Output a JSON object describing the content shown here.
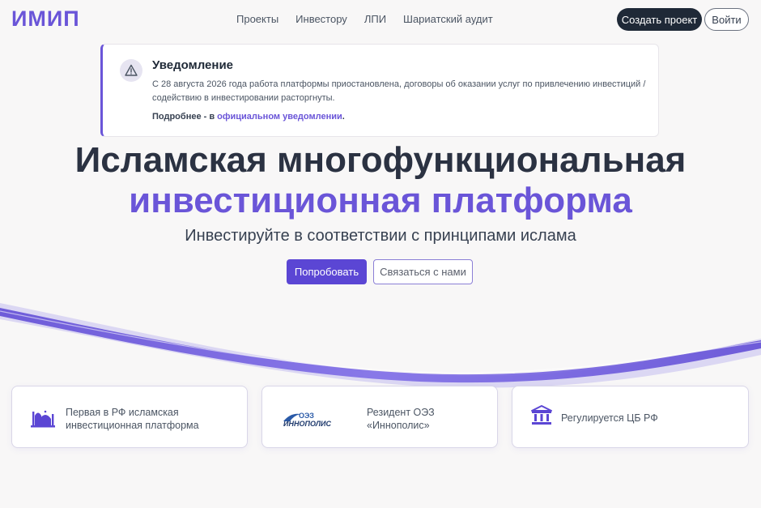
{
  "header": {
    "logo": "ИМИП",
    "nav": [
      "Проекты",
      "Инвестору",
      "ЛПИ",
      "Шариатский аудит"
    ],
    "create_project": "Создать проект",
    "login": "Войти"
  },
  "notice": {
    "title": "Уведомление",
    "text": "С 28 августа 2026 года работа платформы приостановлена, договоры об оказании услуг по привлечению инвестиций / содействию в инвестировании расторгнуты.",
    "more_prefix": "Подробнее - в ",
    "more_link": "официальном уведомлении",
    "more_suffix": "."
  },
  "hero": {
    "title_line1": "Исламская многофункциональная",
    "title_line2": "инвестиционная платформа",
    "subtitle": "Инвестируйте в соответствии с принципами ислама",
    "try_button": "Попробовать",
    "contact_button": "Связаться с нами"
  },
  "cards": [
    {
      "icon": "mosque-icon",
      "line1": "Первая в РФ исламская",
      "line2": "инвестиционная платформа"
    },
    {
      "icon": "innopolis-logo",
      "logo_top": "ОЭЗ",
      "logo_bottom": "ИННОПОЛИС",
      "line1": "Резидент ОЭЗ",
      "line2": "«Иннополис»"
    },
    {
      "icon": "bank-icon",
      "line1": "Регулируется ЦБ РФ"
    }
  ],
  "colors": {
    "accent": "#6a55d8",
    "primary_button": "#5b46d4",
    "dark_button": "#1f2937",
    "background": "#f8f7f7",
    "heading": "#2b3242"
  }
}
